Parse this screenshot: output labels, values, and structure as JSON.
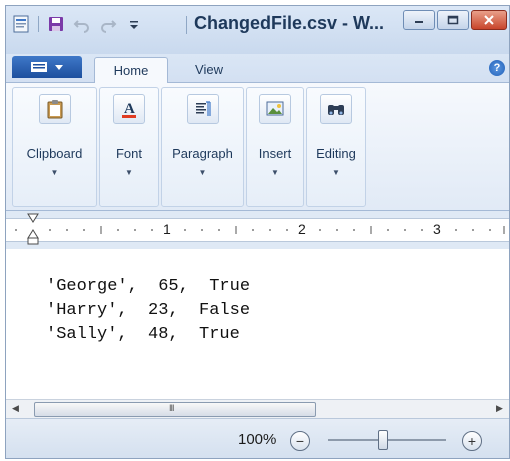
{
  "window": {
    "title": "ChangedFile.csv - W...",
    "accent": "#1d4f9e",
    "close_color": "#c8452b"
  },
  "quick_access": [
    "app-icon",
    "save-icon",
    "undo-icon",
    "redo-icon",
    "customize-dropdown-icon"
  ],
  "tabs": [
    {
      "label": "Home",
      "active": true
    },
    {
      "label": "View",
      "active": false
    }
  ],
  "help_glyph": "?",
  "ribbon": {
    "groups": [
      {
        "label": "Clipboard",
        "icon": "clipboard-icon"
      },
      {
        "label": "Font",
        "icon": "font-color-icon"
      },
      {
        "label": "Paragraph",
        "icon": "paragraph-icon"
      },
      {
        "label": "Insert",
        "icon": "picture-icon"
      },
      {
        "label": "Editing",
        "icon": "binoculars-icon"
      }
    ]
  },
  "ruler": {
    "numbers": [
      "1",
      "2",
      "3"
    ]
  },
  "document": {
    "lines": [
      "'George',  65,  True",
      "'Harry',  23,  False",
      "'Sally',  48,  True"
    ]
  },
  "scrollbar": {
    "grip": "III"
  },
  "status": {
    "zoom": "100%",
    "zoom_out_glyph": "−",
    "zoom_in_glyph": "+"
  }
}
